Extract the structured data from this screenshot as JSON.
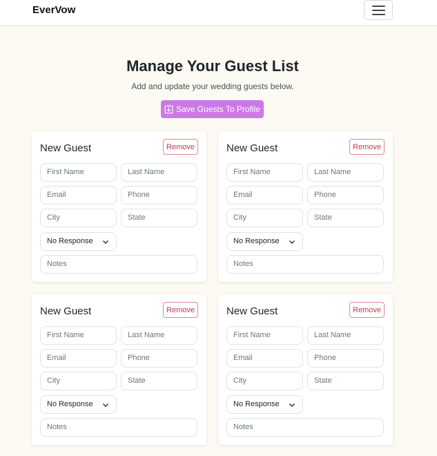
{
  "navbar": {
    "brand": "EverVow",
    "menu_icon": "hamburger-menu-icon"
  },
  "header": {
    "title": "Manage Your Guest List",
    "subtitle": "Add and update your wedding guests below.",
    "save_label": "Save Guests To Profile",
    "save_icon": "download-icon",
    "accent_color": "#cc79e8"
  },
  "guests": [
    {
      "title": "New Guest",
      "remove_label": "Remove",
      "first_name": "First Name",
      "last_name": "Last Name",
      "email": "Email",
      "phone": "Phone",
      "city": "City",
      "state": "State",
      "response": "No Response",
      "notes": "Notes"
    },
    {
      "title": "New Guest",
      "remove_label": "Remove",
      "first_name": "First Name",
      "last_name": "Last Name",
      "email": "Email",
      "phone": "Phone",
      "city": "City",
      "state": "State",
      "response": "No Response",
      "notes": "Notes"
    },
    {
      "title": "New Guest",
      "remove_label": "Remove",
      "first_name": "First Name",
      "last_name": "Last Name",
      "email": "Email",
      "phone": "Phone",
      "city": "City",
      "state": "State",
      "response": "No Response",
      "notes": "Notes"
    },
    {
      "title": "New Guest",
      "remove_label": "Remove",
      "first_name": "First Name",
      "last_name": "Last Name",
      "email": "Email",
      "phone": "Phone",
      "city": "City",
      "state": "State",
      "response": "No Response",
      "notes": "Notes"
    }
  ]
}
